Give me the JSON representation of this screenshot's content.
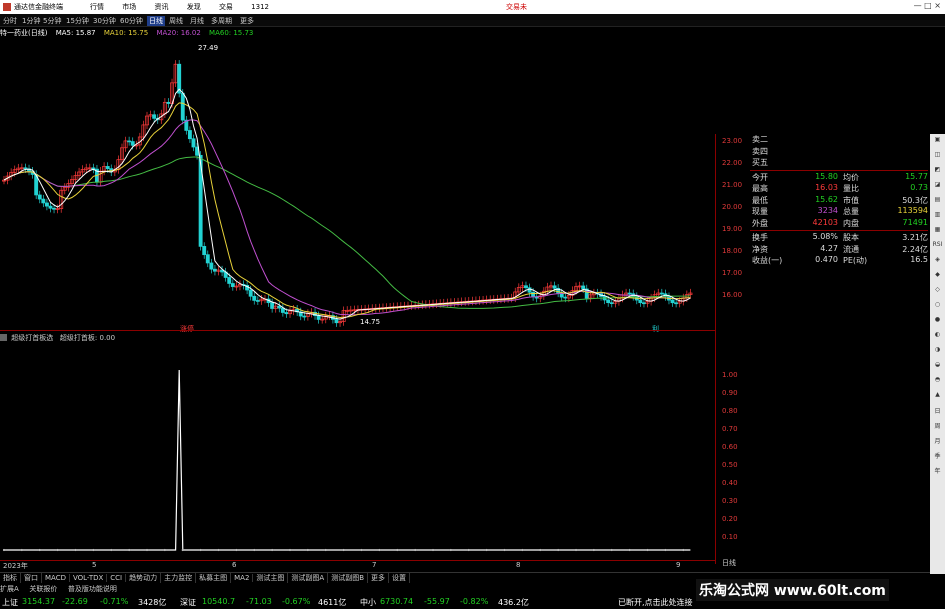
{
  "window": {
    "app_name": "通达信金融终端",
    "menu": [
      "行情",
      "市场",
      "资讯",
      "发现",
      "交易",
      "1312"
    ],
    "trade_label": "交易未",
    "controls": "— □ ×"
  },
  "periods": [
    "分时",
    "1分钟",
    "5分钟",
    "15分钟",
    "30分钟",
    "60分钟",
    "日线",
    "周线",
    "月线",
    "多周期",
    "更多"
  ],
  "selected_period": "日线",
  "ma_legend": {
    "name": "特一药业(日线)",
    "ma5": "MA5: 15.87",
    "ma10": "MA10: 15.75",
    "ma20": "MA20: 16.02",
    "ma60": "MA60: 15.73"
  },
  "price_annotations": {
    "high": "27.49",
    "low": "14.75"
  },
  "price_axis": [
    "23.00",
    "22.00",
    "21.00",
    "20.00",
    "19.00",
    "18.00",
    "17.00",
    "16.00"
  ],
  "markers": {
    "left": "涨停",
    "right": "利"
  },
  "sub_indicator": {
    "title": "超级打首板选",
    "label": "超级打首板: 0.00",
    "axis": [
      "1.00",
      "0.90",
      "0.80",
      "0.70",
      "0.60",
      "0.50",
      "0.40",
      "0.30",
      "0.20",
      "0.10"
    ]
  },
  "x_labels": [
    "2023年",
    "5",
    "6",
    "7",
    "8",
    "9"
  ],
  "day_axis_label": "日线",
  "quote": {
    "rows_top": [
      "卖二",
      "卖四",
      "买五"
    ],
    "rows": [
      {
        "l1": "今开",
        "v1": "15.80",
        "c1": "#22d022",
        "l2": "均价",
        "v2": "15.77",
        "c2": "#22d022"
      },
      {
        "l1": "最高",
        "v1": "16.03",
        "c1": "#ff3b3b",
        "l2": "量比",
        "v2": "0.73",
        "c2": "#22d022"
      },
      {
        "l1": "最低",
        "v1": "15.62",
        "c1": "#22d022",
        "l2": "市值",
        "v2": "50.3亿",
        "c2": "#dddddd"
      },
      {
        "l1": "现量",
        "v1": "3234",
        "c1": "#c050d0",
        "l2": "总量",
        "v2": "113594",
        "c2": "#e8d23a"
      },
      {
        "l1": "外盘",
        "v1": "42103",
        "c1": "#ff3b3b",
        "l2": "内盘",
        "v2": "71491",
        "c2": "#22d022"
      }
    ],
    "rows2": [
      {
        "l1": "换手",
        "v1": "5.08%",
        "c1": "#dddddd",
        "l2": "股本",
        "v2": "3.21亿",
        "c2": "#dddddd"
      },
      {
        "l1": "净资",
        "v1": "4.27",
        "c1": "#dddddd",
        "l2": "流通",
        "v2": "2.24亿",
        "c2": "#dddddd"
      },
      {
        "l1": "收益(一)",
        "v1": "0.470",
        "c1": "#dddddd",
        "l2": "PE(动)",
        "v2": "16.5",
        "c2": "#dddddd"
      }
    ]
  },
  "vtoolbar": [
    "RSI",
    "日",
    "周",
    "月",
    "季",
    "年"
  ],
  "tabs": [
    "指标",
    "窗口",
    "MACD",
    "VOL-TDX",
    "CCI",
    "趋势动力",
    "主力监控",
    "私募主图",
    "MA2",
    "测试主图",
    "测试副图A",
    "测试副图B",
    "更多",
    "设置"
  ],
  "tabs2": [
    "扩展A",
    "关联报价",
    "普及版功能说明"
  ],
  "status": {
    "sh_name": "上证",
    "sh_value": "3154.37",
    "sh_change": "-22.69",
    "sh_pct": "-0.71%",
    "sh_amount": "3428亿",
    "sz_name": "深证",
    "sz_value": "10540.7",
    "sz_change": "-71.03",
    "sz_pct": "-0.67%",
    "sz_amount": "4611亿",
    "zx_name": "中小",
    "zx_value": "6730.74",
    "zx_change": "-55.97",
    "zx_pct": "-0.82%",
    "zx_amount": "436.2亿",
    "link": "已断开,点击此处连接"
  },
  "watermark": "乐淘公式网 www.60lt.com",
  "colors": {
    "up": "#ff3b3b",
    "down": "#22d3d3",
    "ma5": "#ffffff",
    "ma10": "#e8d23a",
    "ma20": "#c050d0",
    "ma60": "#44bb44",
    "axis": "#8b0000"
  }
}
